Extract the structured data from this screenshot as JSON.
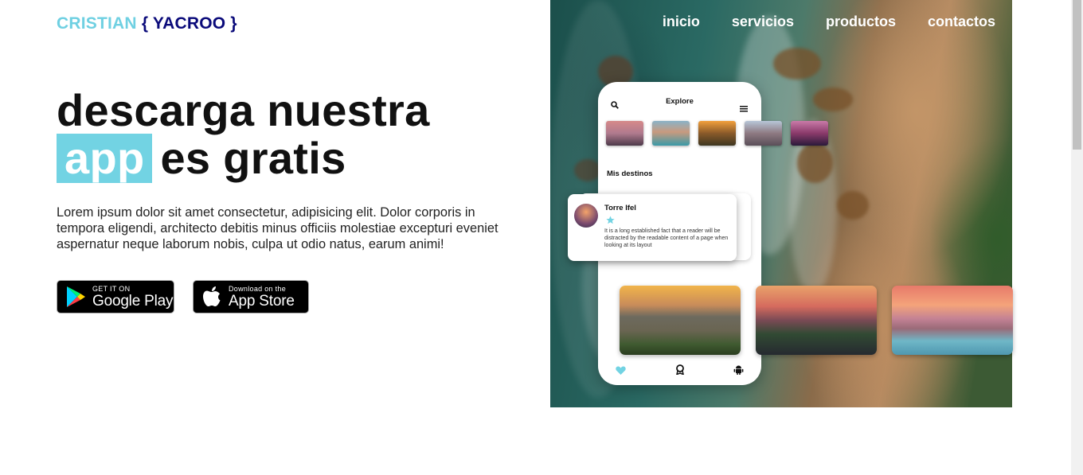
{
  "logo": {
    "first": "CRISTIAN",
    "last": "{ YACROO }"
  },
  "nav": {
    "items": [
      "inicio",
      "servicios",
      "productos",
      "contactos"
    ]
  },
  "hero": {
    "title_line1": "descarga nuestra",
    "title_highlight": "app",
    "title_rest": "es gratis",
    "description": "Lorem ipsum dolor sit amet consectetur, adipisicing elit. Dolor corporis in tempora eligendi, architecto debitis minus officiis molestiae excepturi eveniet aspernatur neque laborum nobis, culpa ut odio natus, earum animi!"
  },
  "stores": {
    "google": {
      "small": "GET IT ON",
      "big": "Google Play"
    },
    "apple": {
      "small": "Download on the",
      "big": "App Store"
    }
  },
  "phone": {
    "title": "Explore",
    "section": "Mis destinos",
    "card": {
      "name": "Torre Ifel",
      "text": "It is a long established fact that a reader will be distracted by the readable content of a page when looking at its layout"
    }
  },
  "colors": {
    "accent": "#72d3e3",
    "logo_first": "#6fd0e2",
    "logo_last": "#0a0a7a"
  }
}
